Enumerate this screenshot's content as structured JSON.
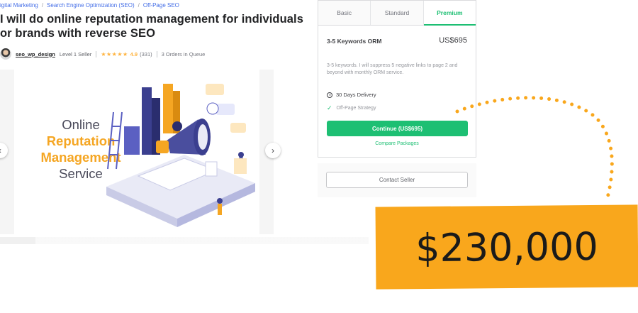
{
  "breadcrumb": {
    "items": [
      "igital Marketing",
      "Search Engine Optimization (SEO)",
      "Off-Page SEO"
    ],
    "separator": "/"
  },
  "gig": {
    "title": "I will do online reputation management for individuals or brands with reverse SEO"
  },
  "seller": {
    "username": "seo_wp_design",
    "level": "Level 1 Seller",
    "stars": "★★★★★",
    "rating": "4.9",
    "reviews": "(331)",
    "orders_in_queue": "3 Orders in Queue"
  },
  "gallery": {
    "slide_text": [
      "Online",
      "Reputation",
      "Management",
      "Service"
    ],
    "prev_icon": "‹",
    "next_icon": "›"
  },
  "package": {
    "tabs": [
      "Basic",
      "Standard",
      "Premium"
    ],
    "active_tab": "Premium",
    "name": "3-5 Keywords ORM",
    "price": "US$695",
    "description": "3-5 keywords. I will suppress 5 negative links to page 2 and beyond with monthly ORM service.",
    "delivery": "30 Days Delivery",
    "features": [
      "Off-Page Strategy"
    ],
    "continue_label": "Continue (US$695)",
    "compare_label": "Compare Packages"
  },
  "contact": {
    "label": "Contact Seller"
  },
  "overlay": {
    "amount": "$230,000"
  },
  "colors": {
    "accent": "#1dbf73",
    "star": "#ffb33e",
    "overlay_bg": "#f9a71c",
    "link": "#446ee7"
  }
}
